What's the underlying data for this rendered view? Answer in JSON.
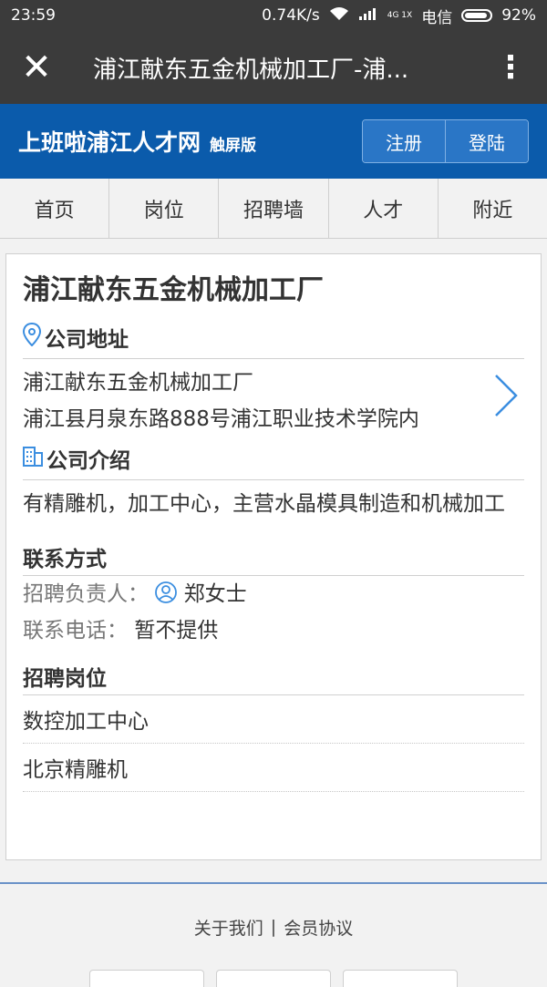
{
  "status": {
    "time": "23:59",
    "speed": "0.74K/s",
    "network": "4G 1X",
    "carrier": "电信",
    "battery": "92%",
    "battery_level": 0.92
  },
  "browser": {
    "title": "浦江献东五金机械加工厂-浦...",
    "close_icon": "✕",
    "more_icon": "⋮"
  },
  "site": {
    "brand": "上班啦浦江人才网",
    "brand_sub": "触屏版",
    "register": "注册",
    "login": "登陆"
  },
  "nav": [
    "首页",
    "岗位",
    "招聘墙",
    "人才",
    "附近"
  ],
  "company": {
    "name": "浦江献东五金机械加工厂",
    "address_title": "公司地址",
    "address_line1": "浦江献东五金机械加工厂",
    "address_line2": "浦江县月泉东路888号浦江职业技术学院内",
    "intro_title": "公司介绍",
    "intro_text": "有精雕机，加工中心，主营水晶模具制造和机械加工"
  },
  "contact": {
    "title": "联系方式",
    "person_label": "招聘负责人：",
    "person_value": "郑女士",
    "phone_label": "联系电话：",
    "phone_value": "暂不提供"
  },
  "jobs": {
    "title": "招聘岗位",
    "items": [
      "数控加工中心",
      "北京精雕机"
    ]
  },
  "footer": {
    "about": "关于我们",
    "separator": "|",
    "agreement": "会员协议"
  }
}
